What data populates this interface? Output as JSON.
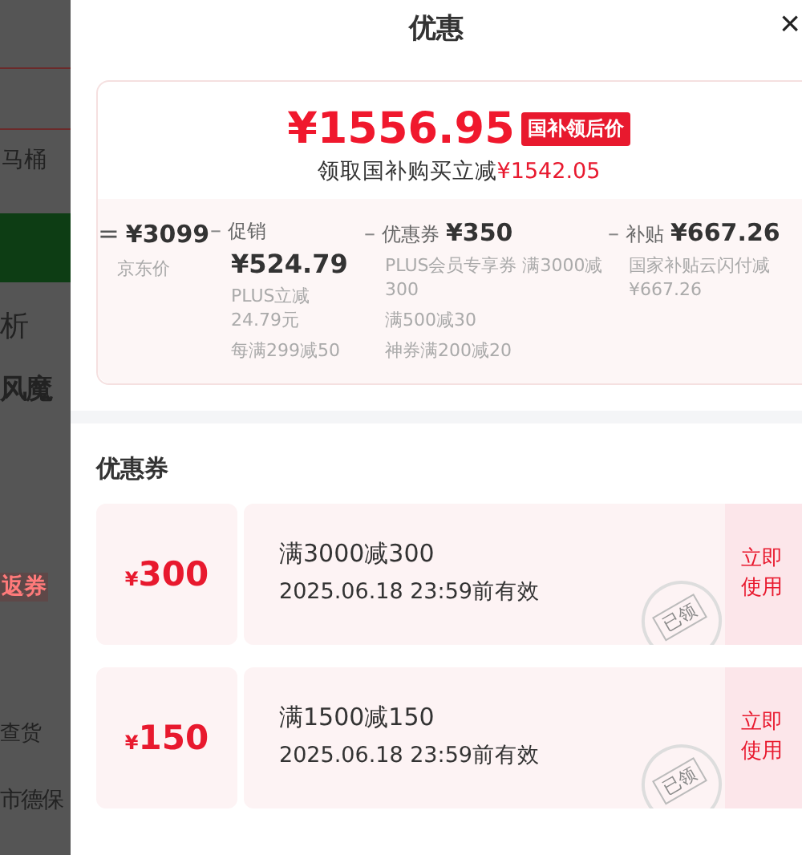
{
  "background": {
    "texts": [
      {
        "text": "马桶",
        "kind": "plain"
      },
      {
        "text": "析",
        "kind": "large"
      },
      {
        "text": "风魔",
        "kind": "large"
      },
      {
        "text": "返券",
        "kind": "tag"
      },
      {
        "text": "查货",
        "kind": "plain"
      },
      {
        "text": "市德保",
        "kind": "plain"
      }
    ]
  },
  "sheet": {
    "title": "优惠",
    "close": "×"
  },
  "price_card": {
    "price": "¥1556.95",
    "badge": "国补领后价",
    "note_prefix": "领取国补购买立减",
    "note_amount": "¥1542.05",
    "breakdown": [
      {
        "operator": "=",
        "amount": "¥3099",
        "details": [
          "京东价"
        ]
      },
      {
        "operator": "–",
        "label": "促销",
        "amount": "¥524.79",
        "details": [
          "PLUS立减 24.79元",
          "每满299减50"
        ]
      },
      {
        "operator": "–",
        "label": "优惠券",
        "amount": "¥350",
        "details": [
          "PLUS会员专享券 满3000减300",
          "满500减30",
          "神券满200减20"
        ]
      },
      {
        "operator": "–",
        "label": "补贴",
        "amount": "¥667.26",
        "details": [
          "国家补贴云闪付减 ¥667.26"
        ]
      }
    ]
  },
  "coupons": {
    "title": "优惠券",
    "items": [
      {
        "currency": "¥",
        "value": "300",
        "condition": "满3000减300",
        "validity": "2025.06.18 23:59前有效",
        "action": "立即使用",
        "claimed": true,
        "stamp": "已领"
      },
      {
        "currency": "¥",
        "value": "150",
        "condition": "满1500减150",
        "validity": "2025.06.18 23:59前有效",
        "action": "立即使用",
        "claimed": true,
        "stamp": "已领"
      }
    ]
  }
}
